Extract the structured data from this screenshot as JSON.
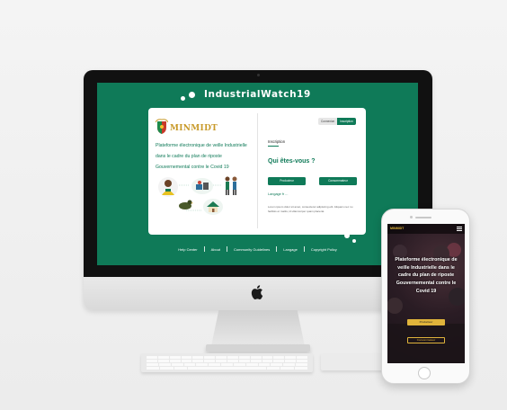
{
  "desktop": {
    "title": "IndustrialWatch19",
    "brand": "MINMIDT",
    "tagline": "Plateforme électronique de veille Industrielle dans le cadre du plan de riposte Gouvernemental contre le Covid 19",
    "tabs": {
      "login": "Connexion",
      "register": "Inscription"
    },
    "section_heading": "Inscription",
    "question": "Qui êtes-vous ?",
    "buttons": {
      "producer": "Producteur",
      "consumer": "Consommateur"
    },
    "language_label": "Langage fr ...",
    "body_text": "Lorem ipsum dolor sit amet, consectetur adipiscing elit. Aliquam nec nu facilisis et mattis, id ullamcorper quam placerat.",
    "footer": [
      "Help Center",
      "About",
      "Community Guidelines",
      "Langage",
      "Copyright Policy"
    ]
  },
  "mobile": {
    "headline": "Plateforme électronique de veille Industrielle dans le cadre du plan de riposte Gouvernemental contre le Covid 19",
    "primary_button": "Producteur",
    "secondary_button": "Consommateur"
  },
  "colors": {
    "brand_green": "#0f7a58",
    "brand_gold": "#c89a2a",
    "mobile_gold": "#e0b43b"
  }
}
